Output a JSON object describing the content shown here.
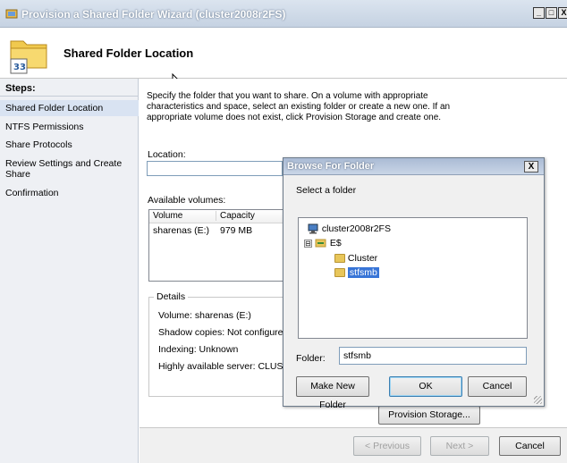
{
  "window": {
    "title": "Provision a Shared Folder Wizard (cluster2008r2FS)",
    "controls": [
      "_",
      "□",
      "X"
    ]
  },
  "header": {
    "title": "Shared Folder Location"
  },
  "steps": {
    "heading": "Steps:",
    "items": [
      {
        "label": "Shared Folder Location",
        "active": true
      },
      {
        "label": "NTFS Permissions",
        "active": false
      },
      {
        "label": "Share Protocols",
        "active": false
      },
      {
        "label": "Review Settings and Create Share",
        "active": false
      },
      {
        "label": "Confirmation",
        "active": false
      }
    ]
  },
  "main": {
    "description": "Specify the folder that you want to share. On a volume with appropriate characteristics and space, select an existing folder or create a new one. If an appropriate volume does not exist, click Provision Storage and create one.",
    "location_label": "Location:",
    "location_value": "",
    "volumes_label": "Available volumes:",
    "volumes_columns": [
      "Volume",
      "Capacity"
    ],
    "volumes_rows": [
      [
        "sharenas (E:)",
        "979 MB"
      ]
    ],
    "details": {
      "legend": "Details",
      "volume": "Volume:   sharenas (E:)",
      "shadow": "Shadow copies:   Not configure",
      "indexing": "Indexing:   Unknown",
      "ha": "Highly available server:   CLUST"
    },
    "provision_button": "Provision Storage..."
  },
  "footer": {
    "previous": "< Previous",
    "next": "Next >",
    "cancel": "Cancel"
  },
  "dialog": {
    "title": "Browse For Folder",
    "close": "X",
    "prompt": "Select a folder",
    "tree": {
      "root": "cluster2008r2FS",
      "drive": "E$",
      "expander": "⊟",
      "children": [
        "Cluster",
        "stfsmb"
      ],
      "selected": "stfsmb"
    },
    "folder_label": "Folder:",
    "folder_value": "stfsmb",
    "make_new_folder": "Make New Folder",
    "ok": "OK",
    "cancel": "Cancel"
  }
}
